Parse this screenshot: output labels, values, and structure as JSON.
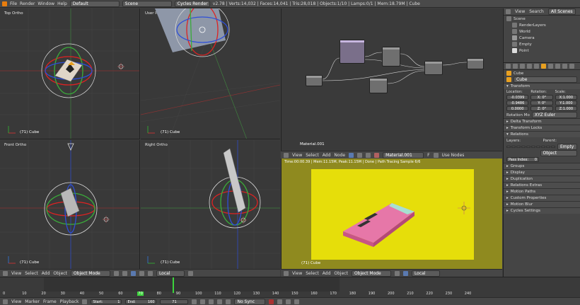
{
  "topbar": {
    "menus": [
      "File",
      "Render",
      "Window",
      "Help"
    ],
    "layout": "Default",
    "scene": "Scene",
    "engine": "Cycles Render",
    "stats": "v2.78 | Verts:14,032 | Faces:14,041 | Tris:28,018 | Objects:1/10 | Lamps:0/1 | Mem:18.79M | Cube"
  },
  "viewports": {
    "tl": "Top Ortho",
    "tr": "User Persp",
    "bl": "Front Ortho",
    "br": "Right Ortho",
    "footer": "(71) Cube"
  },
  "view_header": {
    "menus": [
      "View",
      "Select",
      "Add",
      "Object"
    ],
    "mode": "Object Mode",
    "pivot": "Local"
  },
  "node_editor": {
    "label": "Material.001",
    "menus": [
      "View",
      "Select",
      "Add",
      "Node"
    ],
    "material": "Material.001",
    "material_users": "F",
    "use_nodes": "Use Nodes"
  },
  "render": {
    "status": "Time:00:00.39 | Mem:11.15M, Peak:11.15M | Done | Path Tracing Sample 6/6",
    "footer": "(71) Cube",
    "bg": "#e6de0a",
    "border": "#8f8a1f"
  },
  "outliner": {
    "tabs": [
      "View",
      "Search",
      "All Scenes"
    ],
    "items": [
      "Scene",
      "RenderLayers",
      "World",
      "Camera",
      "Empty",
      "Point"
    ]
  },
  "properties": {
    "object_name_crumb": "Cube",
    "object_name": "Cube",
    "transform": "Transform",
    "location_label": "Location:",
    "rotation_label": "Rotation:",
    "scale_label": "Scale:",
    "loc": [
      "-0.0399",
      "-0.9486",
      "0.0000"
    ],
    "rot_axes": [
      "X:",
      "Y:",
      "Z:"
    ],
    "rot": [
      "0°",
      "0°",
      "0°"
    ],
    "scale_axes": [
      "X:",
      "Y:",
      "Z:"
    ],
    "scale": [
      "1.000",
      "1.000",
      "1.000"
    ],
    "rotation_mode_label": "Rotation Mo",
    "rotation_mode": "XYZ Euler",
    "delta": "Delta Transform",
    "locks": "Transform Locks",
    "relations": "Relations",
    "layers_label": "Layers:",
    "parent_label": "Parent:",
    "parent": "Empty",
    "parent_type": "Object",
    "pass_index": "Pass Index:",
    "pass_value": "0",
    "sections": [
      "Groups",
      "Display",
      "Duplication",
      "Relations Extras",
      "Motion Paths",
      "Custom Properties",
      "Motion Blur",
      "Cycles Settings"
    ]
  },
  "timeline": {
    "ticks": [
      "0",
      "10",
      "20",
      "30",
      "40",
      "50",
      "60",
      "70",
      "80",
      "90",
      "100",
      "110",
      "120",
      "130",
      "140",
      "150",
      "160",
      "170",
      "180",
      "190",
      "200",
      "210",
      "220",
      "230",
      "240"
    ],
    "current": "70",
    "menus": [
      "View",
      "Marker",
      "Frame",
      "Playback"
    ],
    "start": "Start:",
    "start_val": "1",
    "end": "End:",
    "end_val": "160",
    "frame": "71",
    "sync": "No Sync"
  }
}
